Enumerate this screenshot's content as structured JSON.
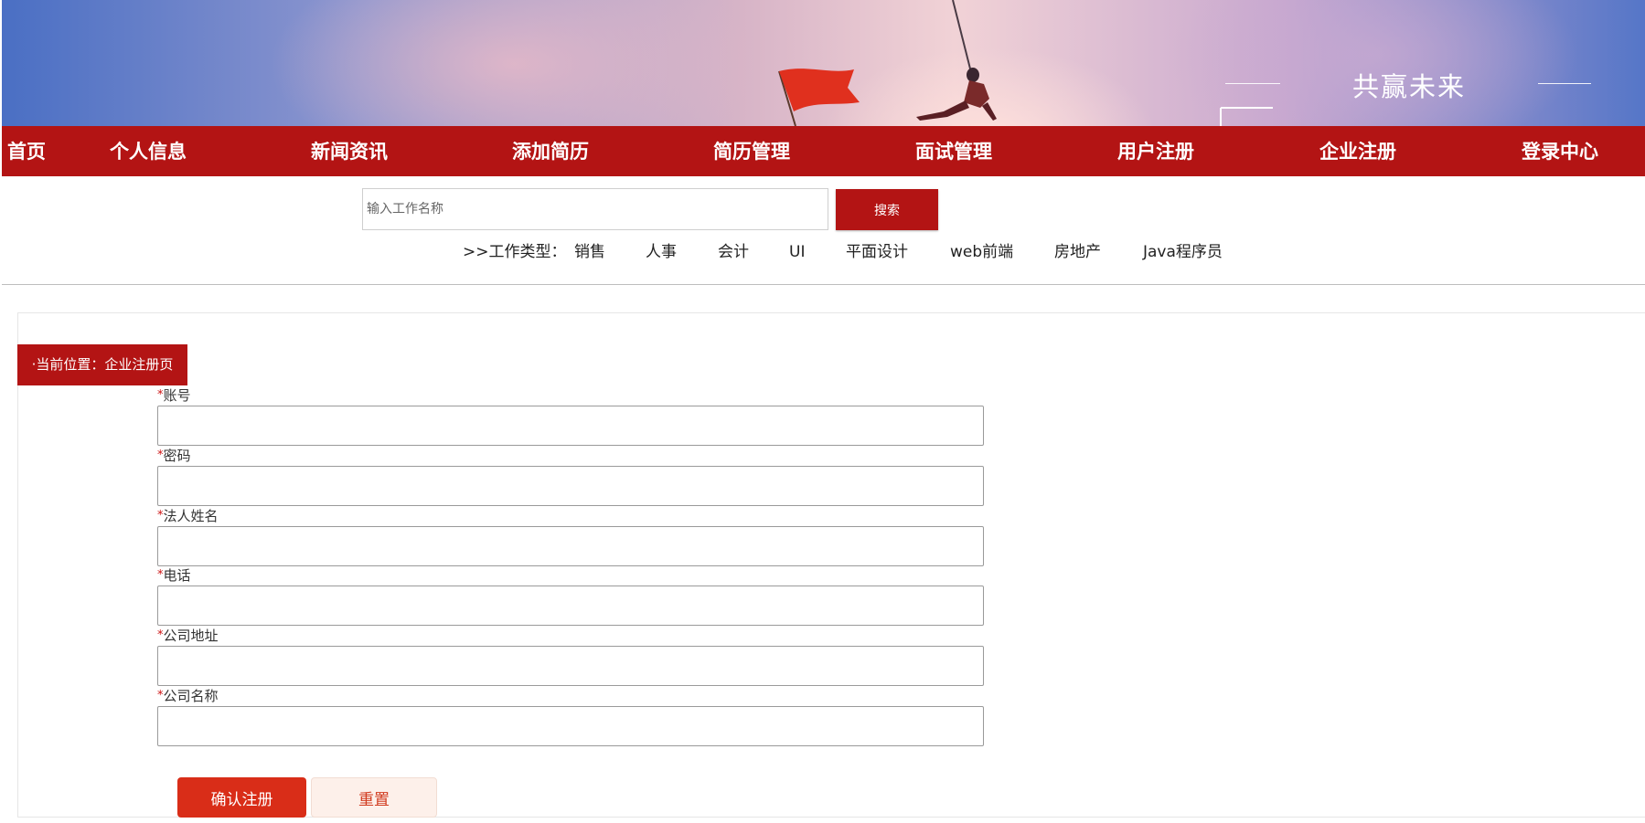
{
  "banner": {
    "slogan": "共赢未来"
  },
  "nav": {
    "items": [
      "首页",
      "个人信息",
      "新闻资讯",
      "添加简历",
      "简历管理",
      "面试管理",
      "用户注册",
      "企业注册",
      "登录中心"
    ]
  },
  "search": {
    "placeholder": "输入工作名称",
    "button_label": "搜索"
  },
  "job_types": {
    "prefix": ">>工作类型：",
    "items": [
      "销售",
      "人事",
      "会计",
      "UI",
      "平面设计",
      "web前端",
      "房地产",
      "Java程序员"
    ]
  },
  "breadcrumb": {
    "text": "·当前位置：企业注册页"
  },
  "form": {
    "required_mark": "*",
    "fields": [
      {
        "label": "账号",
        "value": ""
      },
      {
        "label": "密码",
        "value": ""
      },
      {
        "label": "法人姓名",
        "value": ""
      },
      {
        "label": "电话",
        "value": ""
      },
      {
        "label": "公司地址",
        "value": ""
      },
      {
        "label": "公司名称",
        "value": ""
      }
    ],
    "submit_label": "确认注册",
    "reset_label": "重置"
  },
  "colors": {
    "brand_red": "#b31414",
    "submit_red": "#d92d18"
  }
}
